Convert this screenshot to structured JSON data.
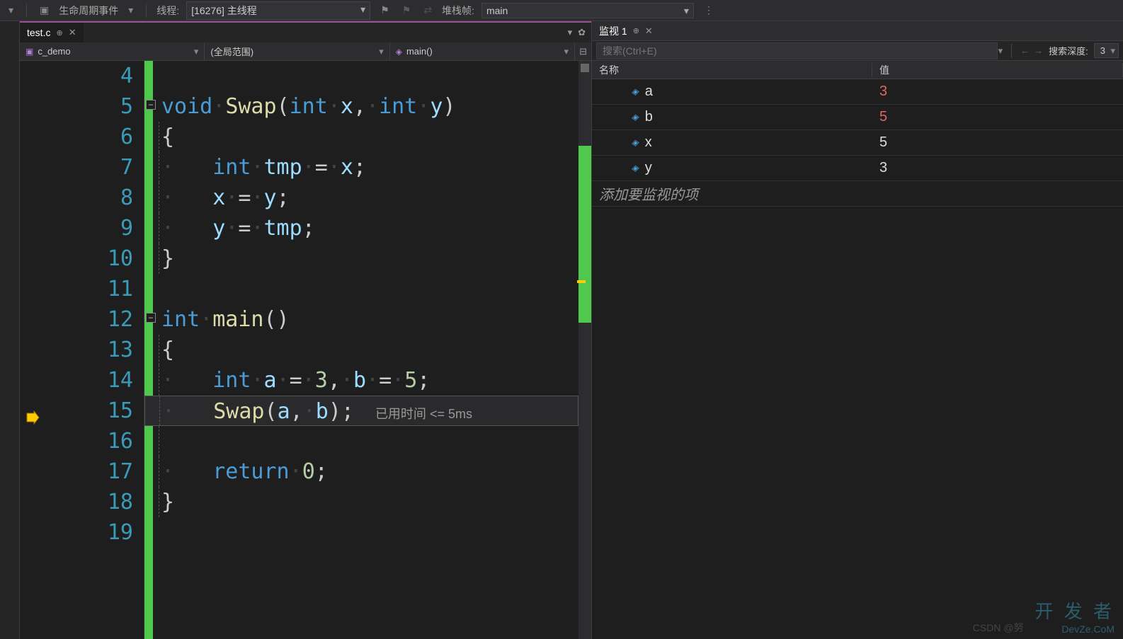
{
  "toolbar": {
    "lifecycle_label": "生命周期事件",
    "thread_label": "线程:",
    "thread_value": "[16276] 主线程",
    "stackframe_label": "堆栈帧:",
    "stackframe_value": "main"
  },
  "tab": {
    "filename": "test.c"
  },
  "nav": {
    "project": "c_demo",
    "scope": "(全局范围)",
    "function": "main()"
  },
  "code": {
    "lines": [
      {
        "n": 4,
        "html": ""
      },
      {
        "n": 5,
        "fold": true,
        "html": "<span class='kw'>void</span><span class='dot'>·</span><span class='fn'>Swap</span>(<span class='kw'>int</span><span class='dot'>·</span><span class='var'>x</span>,<span class='dot'>·</span><span class='kw'>int</span><span class='dot'>·</span><span class='var'>y</span>)"
      },
      {
        "n": 6,
        "guide": true,
        "html": "{"
      },
      {
        "n": 7,
        "guide": true,
        "html": "<span class='dot'>·   </span><span class='kw'>int</span><span class='dot'>·</span><span class='var'>tmp</span><span class='dot'>·</span>=<span class='dot'>·</span><span class='var'>x</span>;"
      },
      {
        "n": 8,
        "guide": true,
        "html": "<span class='dot'>·   </span><span class='var'>x</span><span class='dot'>·</span>=<span class='dot'>·</span><span class='var'>y</span>;"
      },
      {
        "n": 9,
        "guide": true,
        "html": "<span class='dot'>·   </span><span class='var'>y</span><span class='dot'>·</span>=<span class='dot'>·</span><span class='var'>tmp</span>;"
      },
      {
        "n": 10,
        "guide": true,
        "html": "}"
      },
      {
        "n": 11,
        "html": ""
      },
      {
        "n": 12,
        "fold": true,
        "html": "<span class='kw'>int</span><span class='dot'>·</span><span class='fn'>main</span>()"
      },
      {
        "n": 13,
        "guide": true,
        "html": "{"
      },
      {
        "n": 14,
        "guide": true,
        "html": "<span class='dot'>·   </span><span class='kw'>int</span><span class='dot'>·</span><span class='var'>a</span><span class='dot'>·</span>=<span class='dot'>·</span><span class='num'>3</span>,<span class='dot'>·</span><span class='var'>b</span><span class='dot'>·</span>=<span class='dot'>·</span><span class='num'>5</span>;"
      },
      {
        "n": 15,
        "guide": true,
        "current": true,
        "html": "<span class='dot'>·   </span><span class='fn'>Swap</span>(<span class='var'>a</span>,<span class='dot'>·</span><span class='var'>b</span>);",
        "perf": "已用时间 <= 5ms"
      },
      {
        "n": 16,
        "guide": true,
        "html": ""
      },
      {
        "n": 17,
        "guide": true,
        "html": "<span class='dot'>·   </span><span class='kw'>return</span><span class='dot'>·</span><span class='num'>0</span>;"
      },
      {
        "n": 18,
        "guide": true,
        "html": "}"
      },
      {
        "n": 19,
        "html": ""
      }
    ]
  },
  "watch": {
    "title": "监视 1",
    "search_placeholder": "搜索(Ctrl+E)",
    "depth_label": "搜索深度:",
    "depth_value": "3",
    "headers": {
      "name": "名称",
      "value": "值"
    },
    "rows": [
      {
        "name": "a",
        "value": "3",
        "changed": true
      },
      {
        "name": "b",
        "value": "5",
        "changed": true
      },
      {
        "name": "x",
        "value": "5",
        "changed": false
      },
      {
        "name": "y",
        "value": "3",
        "changed": false
      }
    ],
    "add_placeholder": "添加要监视的项"
  },
  "watermark": {
    "csdn": "CSDN @努",
    "brand": "开 发 者",
    "site": "DevZe.CoM"
  }
}
